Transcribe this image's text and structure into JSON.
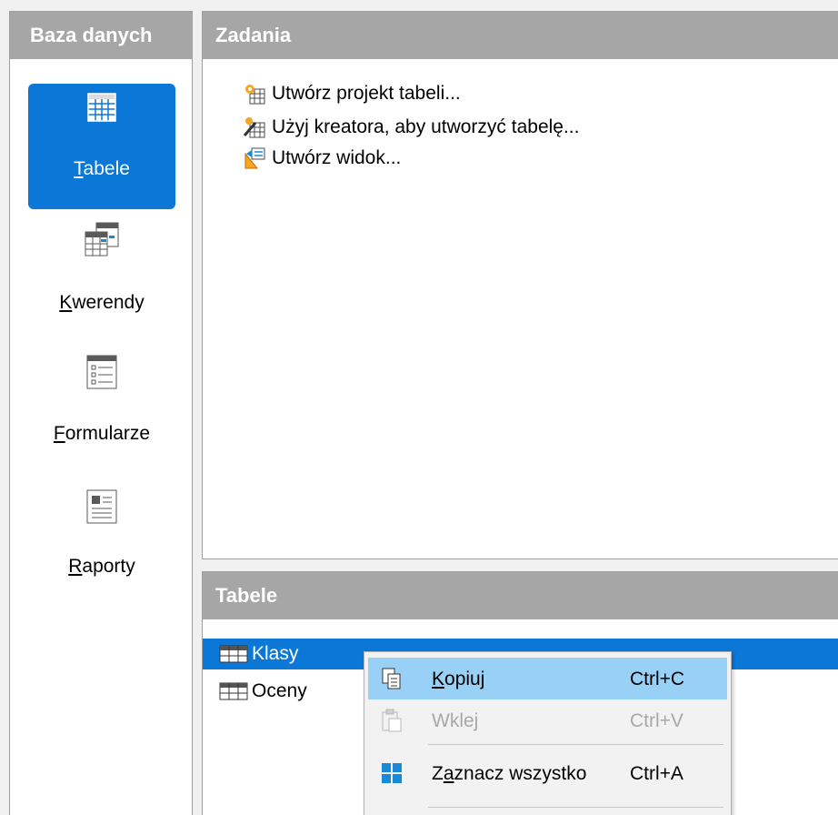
{
  "left_panel": {
    "header": "Baza danych",
    "items": [
      {
        "key": "T",
        "rest": "abele",
        "selected": true
      },
      {
        "key": "K",
        "rest": "werendy",
        "selected": false
      },
      {
        "key": "F",
        "rest": "ormularze",
        "selected": false
      },
      {
        "key": "R",
        "rest": "aporty",
        "selected": false
      }
    ]
  },
  "tasks_panel": {
    "header": "Zadania",
    "tasks": [
      {
        "label": "Utwórz projekt tabeli...",
        "icon": "table-design-icon"
      },
      {
        "label": "Użyj kreatora, aby utworzyć tabelę...",
        "icon": "table-wizard-icon"
      },
      {
        "label": "Utwórz widok...",
        "icon": "create-view-icon"
      }
    ]
  },
  "tables_panel": {
    "header": "Tabele",
    "tables": [
      {
        "label": "Klasy",
        "selected": true
      },
      {
        "label": "Oceny",
        "selected": false
      }
    ]
  },
  "context_menu": {
    "items": [
      {
        "key": "K",
        "rest": "opiuj",
        "shortcut": "Ctrl+C",
        "icon": "copy-icon",
        "state": "hover"
      },
      {
        "pre": "Wkle",
        "key": "j",
        "shortcut": "Ctrl+V",
        "icon": "paste-icon",
        "state": "disabled"
      },
      {
        "pre": "Z",
        "key": "a",
        "rest": "znacz wszystko",
        "shortcut": "Ctrl+A",
        "icon": "select-all-icon",
        "state": "normal"
      }
    ]
  },
  "colors": {
    "accent": "#0b78d7",
    "header_bg": "#a6a6a6",
    "menu_hover": "#99d0f5"
  }
}
